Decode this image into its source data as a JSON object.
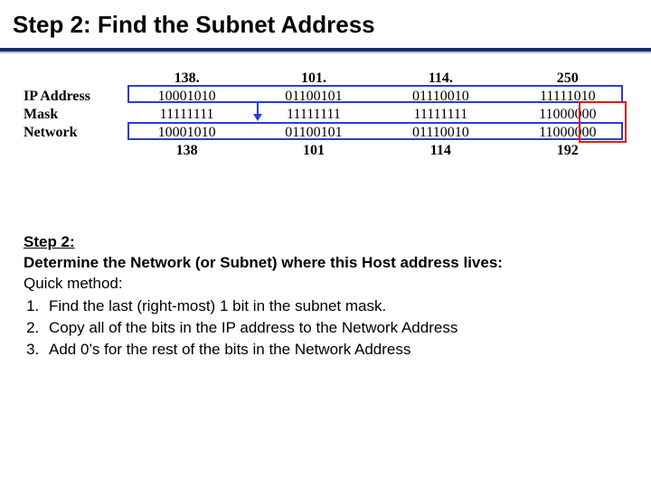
{
  "title": "Step 2: Find the Subnet Address",
  "diagram": {
    "header_dec": [
      "138.",
      "101.",
      "114.",
      "250"
    ],
    "rows": [
      {
        "label": "IP Address",
        "bits": [
          "10001010",
          "01100101",
          "01110010",
          "11111010"
        ]
      },
      {
        "label": "Mask",
        "bits": [
          "11111111",
          "11111111",
          "11111111",
          "11000000"
        ]
      },
      {
        "label": "Network",
        "bits": [
          "10001010",
          "01100101",
          "01110010",
          "11000000"
        ]
      }
    ],
    "footer_dec": [
      "138",
      "101",
      "114",
      "192"
    ]
  },
  "explain": {
    "heading": "Step 2:",
    "subheading": "Determine the Network (or Subnet) where this Host address lives:",
    "quick": "Quick method:",
    "steps": [
      "Find the last (right-most) 1 bit in the subnet mask.",
      "Copy all of the bits in the IP address to the Network Address",
      "Add 0’s for the rest of the bits in the Network Address"
    ]
  }
}
